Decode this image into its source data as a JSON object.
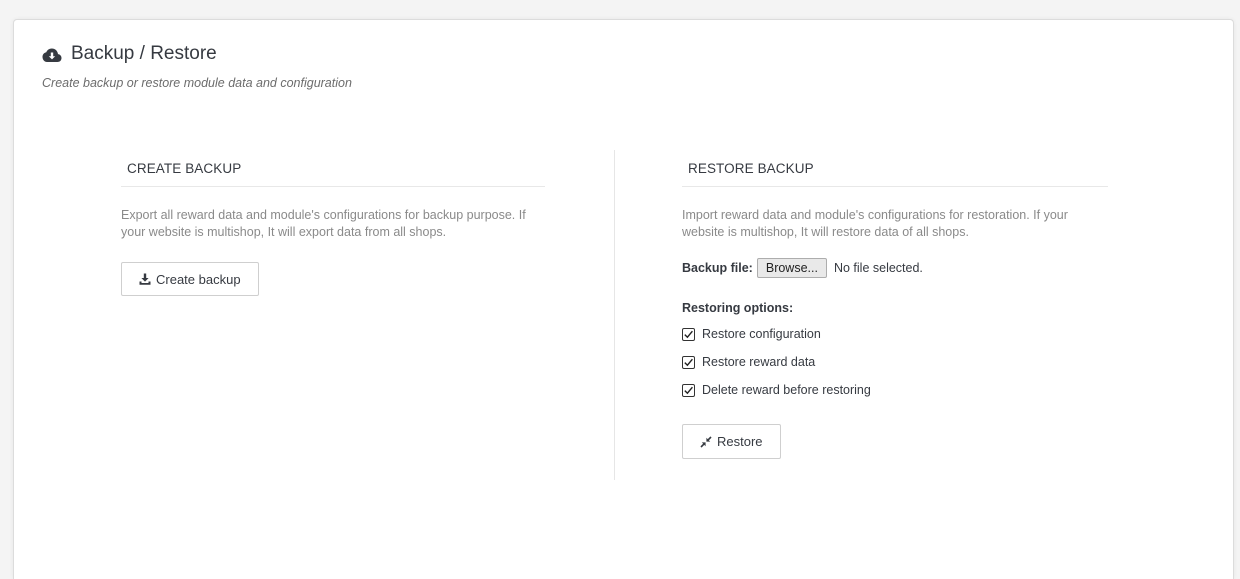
{
  "panel": {
    "title": "Backup / Restore",
    "subtitle": "Create backup or restore module data and configuration",
    "title_icon": "cloud-download-icon"
  },
  "create_backup": {
    "heading": "CREATE BACKUP",
    "description": "Export all reward data and module's configurations for backup purpose. If your website is multishop, It will export data from all shops.",
    "button_label": "Create backup",
    "button_icon": "download-icon"
  },
  "restore_backup": {
    "heading": "RESTORE BACKUP",
    "description": "Import reward data and module's configurations for restoration. If your website is multishop, It will restore data of all shops.",
    "file_label": "Backup file:",
    "browse_label": "Browse...",
    "file_status": "No file selected.",
    "options_heading": "Restoring options:",
    "options": [
      {
        "label": "Restore configuration",
        "checked": true
      },
      {
        "label": "Restore reward data",
        "checked": true
      },
      {
        "label": "Delete reward before restoring",
        "checked": true
      }
    ],
    "button_label": "Restore",
    "button_icon": "compress-arrows-icon"
  },
  "colors": {
    "title": "#363a41",
    "muted_text": "#8a8a8a",
    "border": "#cfcfcf"
  }
}
